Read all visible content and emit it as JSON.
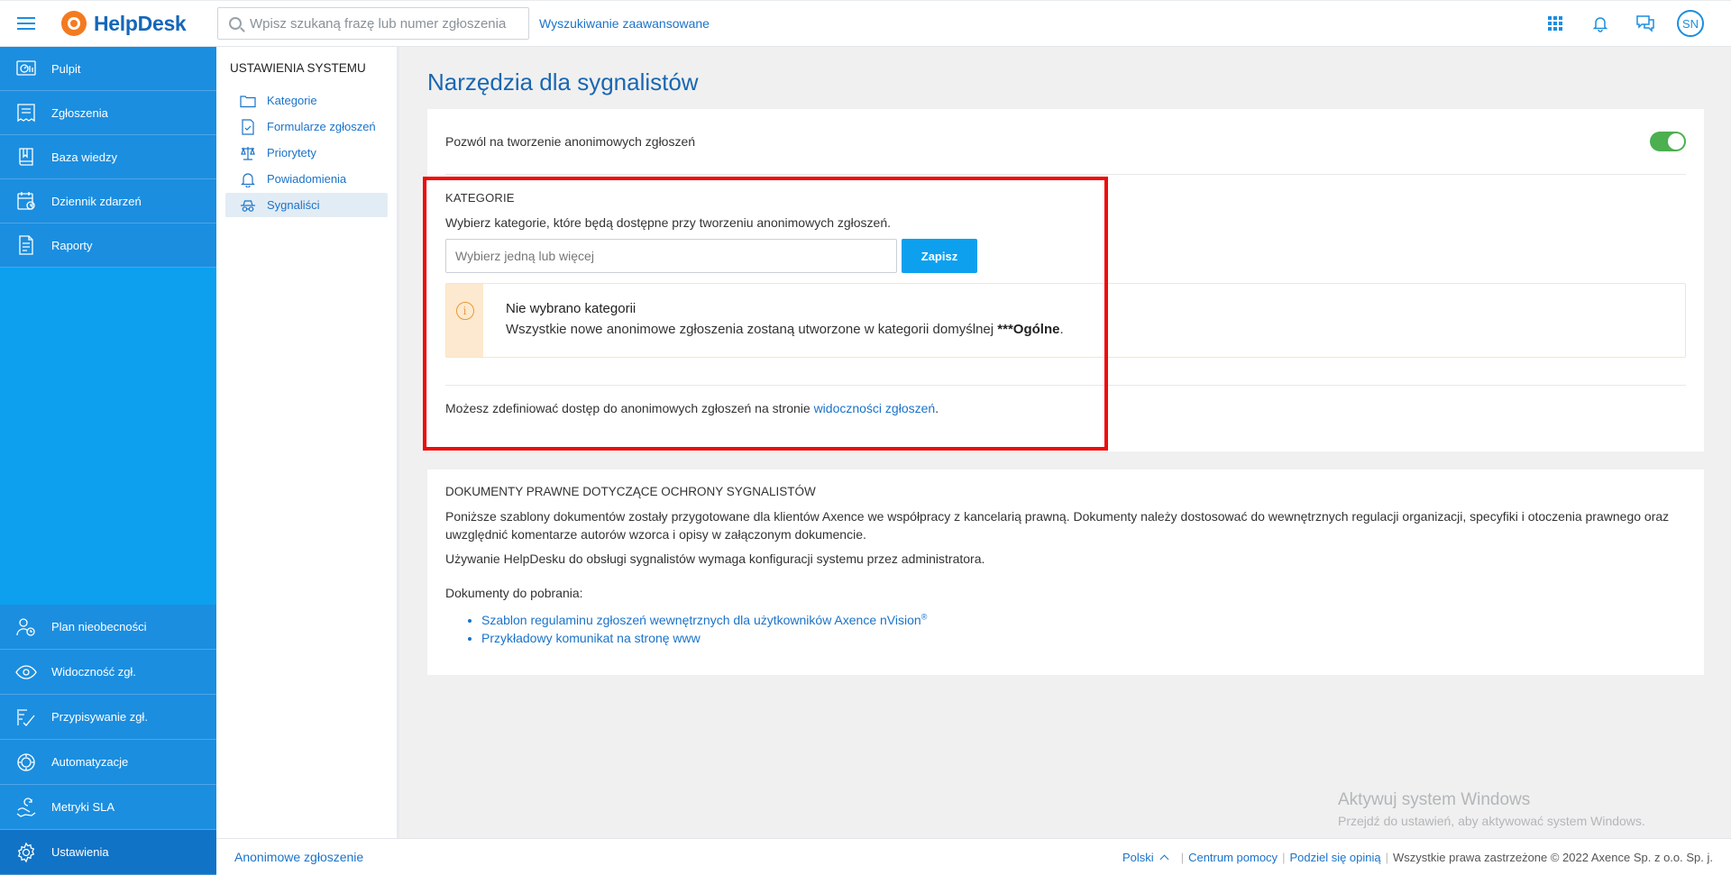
{
  "app": {
    "brand": "HelpDesk",
    "search_placeholder": "Wpisz szukaną frazę lub numer zgłoszenia",
    "advanced_search": "Wyszukiwanie zaawansowane",
    "user_initials": "SN",
    "accent": "#1b8ee0"
  },
  "sidebar": {
    "items_top": [
      {
        "label": "Pulpit",
        "icon": "dashboard-icon"
      },
      {
        "label": "Zgłoszenia",
        "icon": "tickets-icon"
      },
      {
        "label": "Baza wiedzy",
        "icon": "book-icon"
      },
      {
        "label": "Dziennik zdarzeń",
        "icon": "event-log-icon"
      },
      {
        "label": "Raporty",
        "icon": "report-icon"
      }
    ],
    "items_bottom": [
      {
        "label": "Plan nieobecności",
        "icon": "absence-icon"
      },
      {
        "label": "Widoczność zgł.",
        "icon": "eye-icon"
      },
      {
        "label": "Przypisywanie zgł.",
        "icon": "assign-icon"
      },
      {
        "label": "Automatyzacje",
        "icon": "automation-icon"
      },
      {
        "label": "Metryki SLA",
        "icon": "sla-icon"
      },
      {
        "label": "Ustawienia",
        "icon": "gear-icon"
      }
    ]
  },
  "settings_nav": {
    "title": "USTAWIENIA SYSTEMU",
    "items": [
      {
        "label": "Kategorie",
        "icon": "folder-icon"
      },
      {
        "label": "Formularze zgłoszeń",
        "icon": "form-icon"
      },
      {
        "label": "Priorytety",
        "icon": "scales-icon"
      },
      {
        "label": "Powiadomienia",
        "icon": "bell-icon"
      },
      {
        "label": "Sygnaliści",
        "icon": "spy-icon"
      }
    ]
  },
  "main": {
    "title": "Narzędzia dla sygnalistów",
    "anonymous_toggle_label": "Pozwól na tworzenie anonimowych zgłoszeń",
    "anonymous_toggle_on": true,
    "categories": {
      "heading": "KATEGORIE",
      "description": "Wybierz kategorie, które będą dostępne przy tworzeniu anonimowych zgłoszeń.",
      "select_placeholder": "Wybierz jedną lub więcej",
      "save_label": "Zapisz",
      "warning_title": "Nie wybrano kategorii",
      "warning_text": "Wszystkie nowe anonimowe zgłoszenia zostaną utworzone w kategorii domyślnej ",
      "warning_default": "***Ogólne",
      "warning_end": ".",
      "access_text": "Możesz zdefiniować dostęp do anonimowych zgłoszeń na stronie ",
      "access_link": "widoczności zgłoszeń",
      "access_end": "."
    },
    "documents": {
      "heading": "DOKUMENTY PRAWNE DOTYCZĄCE OCHRONY SYGNALISTÓW",
      "paragraph1": "Poniższe szablony dokumentów zostały przygotowane dla klientów Axence we współpracy z kancelarią prawną. Dokumenty należy dostosować do wewnętrznych regulacji organizacji, specyfiki i otoczenia prawnego oraz uwzględnić komentarze autorów wzorca i opisy w załączonym dokumencie.",
      "paragraph2": "Używanie HelpDesku do obsługi sygnalistów wymaga konfiguracji systemu przez administratora.",
      "downloads_label": "Dokumenty do pobrania:",
      "link1": "Szablon regulaminu zgłoszeń wewnętrznych dla użytkowników Axence nVision",
      "link1_sup": "®",
      "link2": "Przykładowy komunikat na stronę www"
    }
  },
  "watermark": {
    "title": "Aktywuj system Windows",
    "subtitle": "Przejdź do ustawień, aby aktywować system Windows."
  },
  "footer": {
    "left_link": "Anonimowe zgłoszenie",
    "language": "Polski",
    "help": "Centrum pomocy",
    "share": "Podziel się opinią",
    "copyright": "Wszystkie prawa zastrzeżone © 2022 Axence Sp. z o.o. Sp. j."
  }
}
